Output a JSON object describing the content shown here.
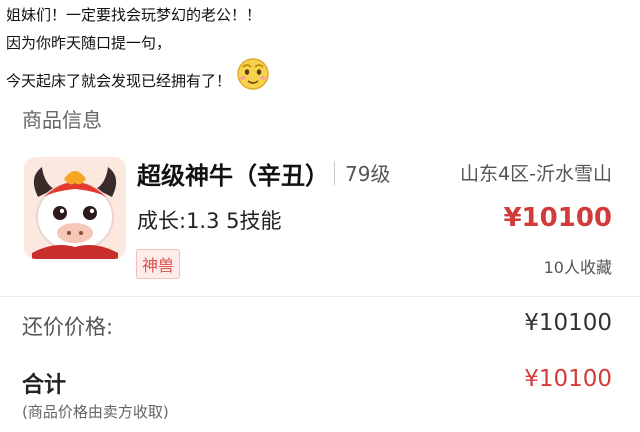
{
  "post": {
    "line1": "姐妹们！一定要找会玩梦幻的老公！！",
    "line2": "因为你昨天随口提一句，",
    "line3": "今天起床了就会发现已经拥有了！"
  },
  "section_title": "商品信息",
  "item": {
    "name": "超级神牛（辛丑）",
    "level": "79级",
    "server": "山东4区-沂水雪山",
    "stats": "成长:1.3 5技能",
    "price": "¥10100",
    "badge": "神兽",
    "favorites": "10人收藏"
  },
  "bargain": {
    "label": "还价价格:",
    "value": "¥10100"
  },
  "total": {
    "label": "合计",
    "value": "¥10100",
    "note": "(商品价格由卖方收取)"
  },
  "colors": {
    "price_red": "#d33a3a",
    "badge_red": "#d9534f"
  },
  "icons": {
    "post_emoji": "smiling-face-icon",
    "item_image": "ox-pet-icon"
  }
}
